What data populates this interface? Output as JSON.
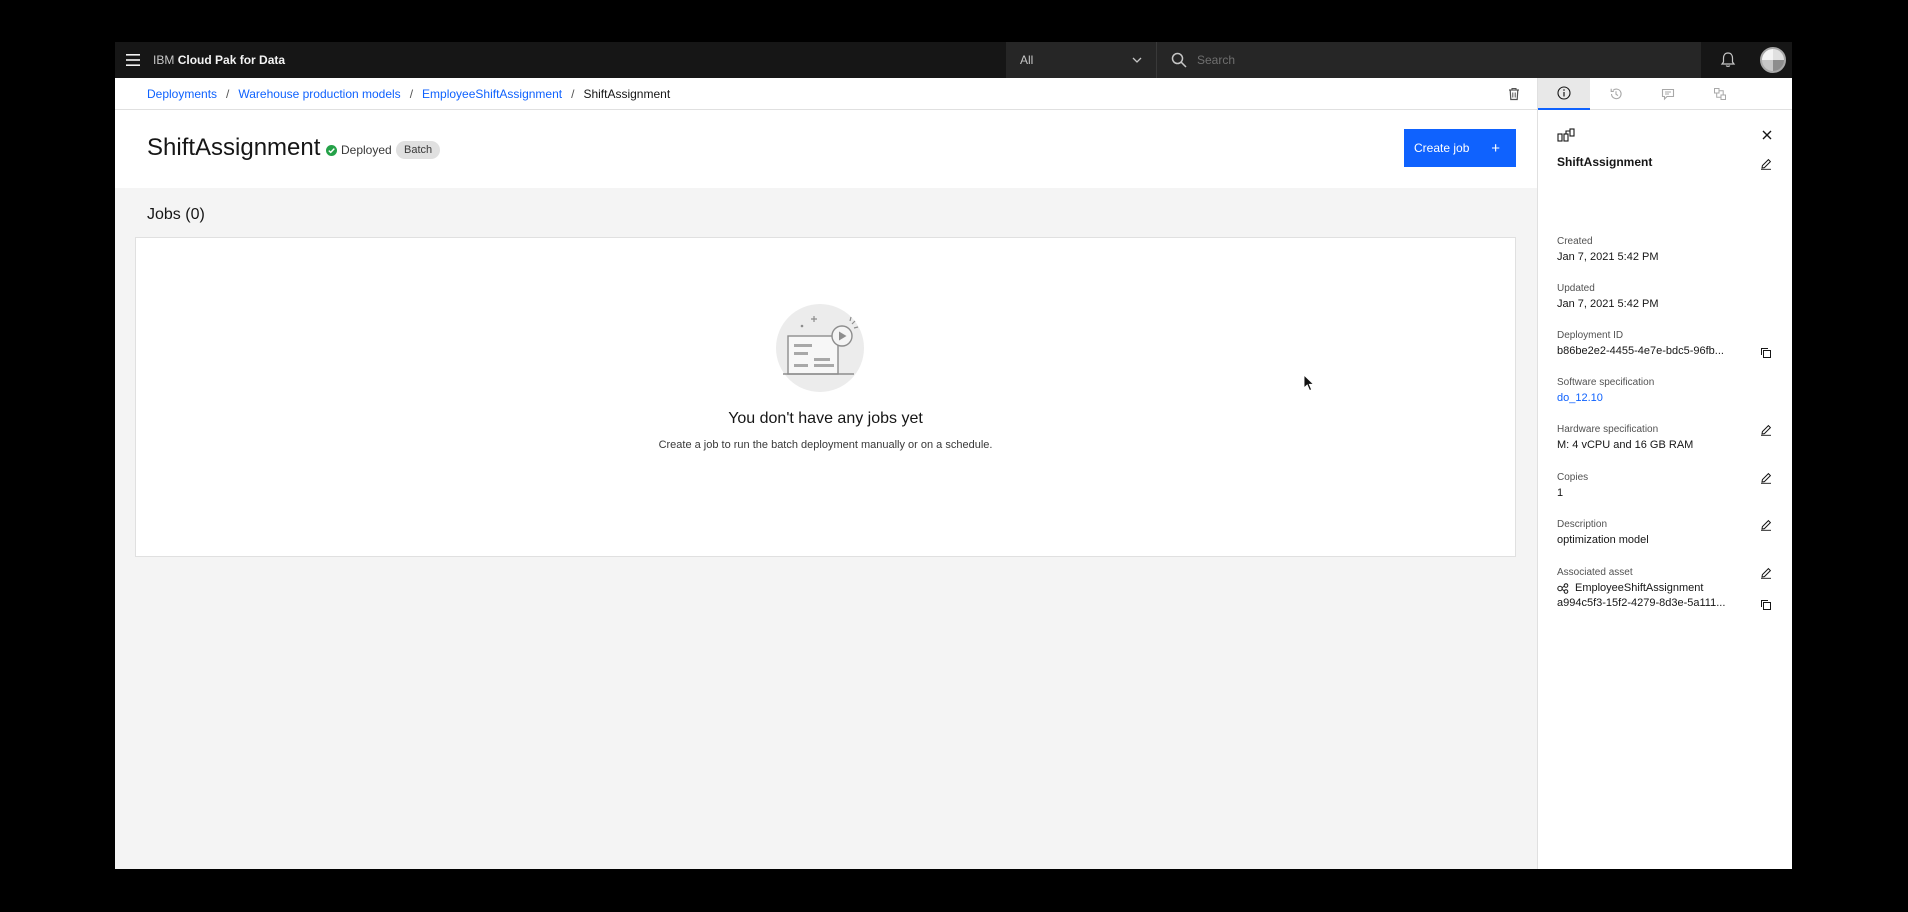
{
  "header": {
    "brand_prefix": "IBM",
    "brand_name": "Cloud Pak for Data",
    "scope_value": "All",
    "search_placeholder": "Search"
  },
  "breadcrumb": {
    "items": [
      "Deployments",
      "Warehouse production models",
      "EmployeeShiftAssignment"
    ],
    "current": "ShiftAssignment",
    "separator": "/"
  },
  "main": {
    "title": "ShiftAssignment",
    "status": "Deployed",
    "tag": "Batch",
    "create_button": "Create job",
    "create_button_icon": "+",
    "jobs_heading": "Jobs (0)",
    "empty_title": "You don't have any jobs yet",
    "empty_subtitle": "Create a job to run the batch deployment manually or on a schedule."
  },
  "panel": {
    "name": "ShiftAssignment",
    "created_label": "Created",
    "created_value": "Jan 7, 2021 5:42 PM",
    "updated_label": "Updated",
    "updated_value": "Jan 7, 2021 5:42 PM",
    "deployment_id_label": "Deployment ID",
    "deployment_id_value": "b86be2e2-4455-4e7e-bdc5-96fb...",
    "software_label": "Software specification",
    "software_value": "do_12.10",
    "hardware_label": "Hardware specification",
    "hardware_value": "M: 4 vCPU and 16 GB RAM",
    "copies_label": "Copies",
    "copies_value": "1",
    "description_label": "Description",
    "description_value": "optimization model",
    "asset_label": "Associated asset",
    "asset_name": "EmployeeShiftAssignment",
    "asset_id": "a994c5f3-15f2-4279-8d3e-5a111..."
  },
  "colors": {
    "accent": "#0f62fe",
    "status_ok": "#24a148",
    "header_bg": "#161616",
    "page_bg": "#f4f4f4"
  }
}
